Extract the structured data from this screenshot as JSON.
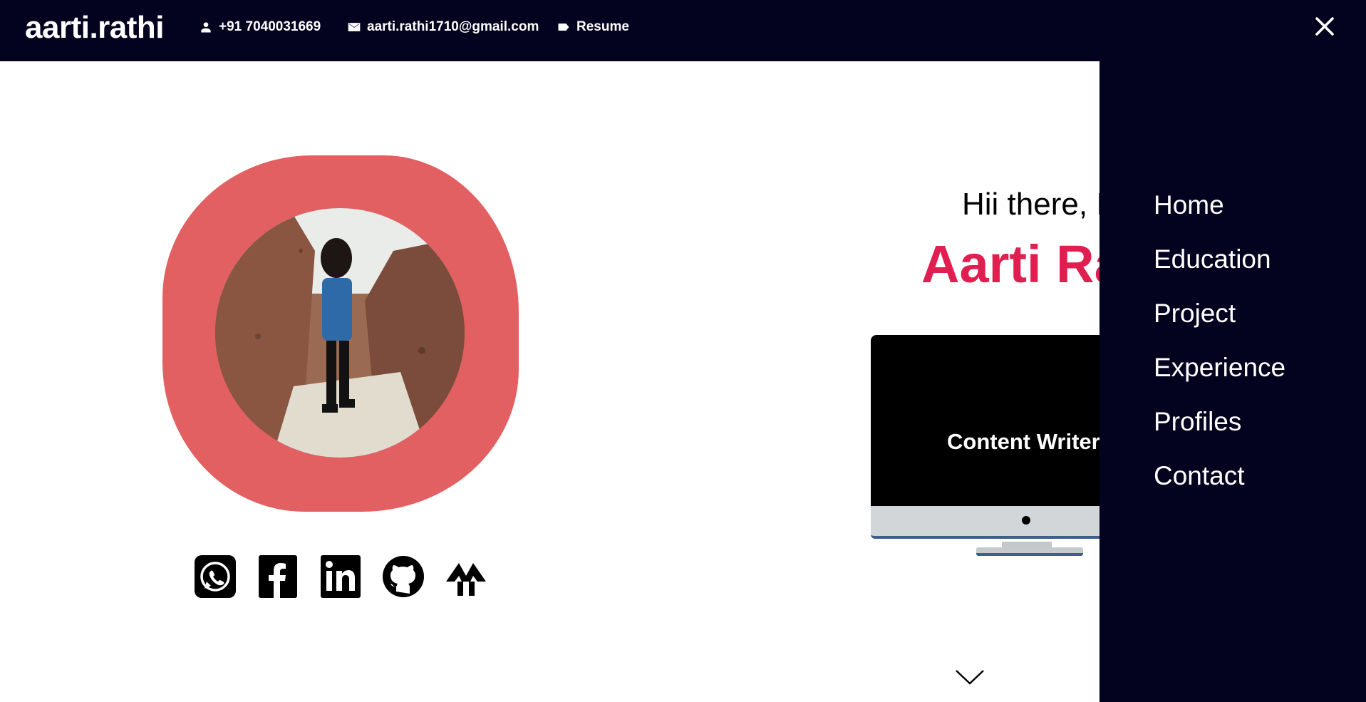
{
  "header": {
    "brand": "aarti.rathi",
    "phone": "+91 7040031669",
    "email": "aarti.rathi1710@gmail.com",
    "resume": "Resume",
    "phone_icon": "person-icon",
    "email_icon": "mail-icon",
    "resume_icon": "label-icon",
    "close_icon": "close-icon"
  },
  "hero": {
    "greeting": "Hii there, I",
    "name": "Aarti Ra",
    "tagline": "Content Writer |",
    "socials": [
      {
        "name": "whatsapp-icon"
      },
      {
        "name": "facebook-icon"
      },
      {
        "name": "linkedin-icon"
      },
      {
        "name": "github-icon"
      },
      {
        "name": "codechef-icon"
      }
    ],
    "scroll_icon": "chevron-down-icon"
  },
  "menu": {
    "items": [
      {
        "label": "Home"
      },
      {
        "label": "Education"
      },
      {
        "label": "Project"
      },
      {
        "label": "Experience"
      },
      {
        "label": "Profiles"
      },
      {
        "label": "Contact"
      }
    ]
  },
  "colors": {
    "navbar": "#03031f",
    "accent_name": "#e01e4f",
    "blob": "#e26062"
  }
}
